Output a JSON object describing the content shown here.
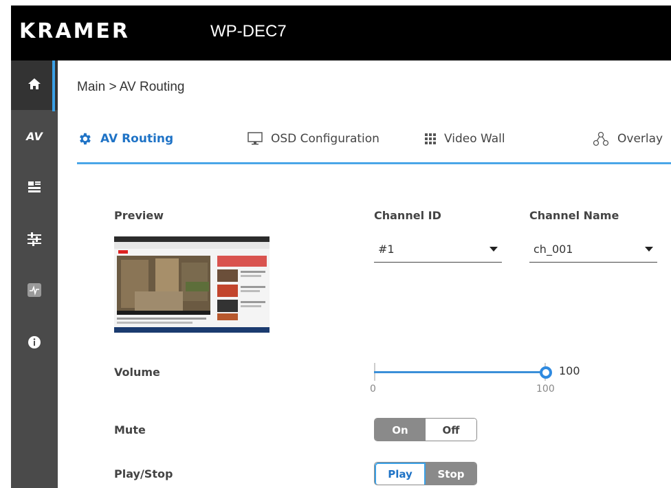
{
  "header": {
    "logo": "KRAMER",
    "product": "WP-DEC7"
  },
  "sidebar": {
    "items": [
      {
        "name": "home-icon"
      },
      {
        "name": "av-icon",
        "label": "AV"
      },
      {
        "name": "settings-panel-icon"
      },
      {
        "name": "sliders-icon"
      },
      {
        "name": "diagnostics-icon"
      },
      {
        "name": "info-icon"
      }
    ]
  },
  "breadcrumb": "Main > AV Routing",
  "tabs": [
    {
      "label": "AV Routing",
      "icon": "gear-icon",
      "active": true
    },
    {
      "label": "OSD Configuration",
      "icon": "monitor-icon"
    },
    {
      "label": "Video Wall",
      "icon": "grid-icon"
    },
    {
      "label": "Overlay",
      "icon": "overlay-icon"
    }
  ],
  "labels": {
    "preview": "Preview",
    "channel_id": "Channel ID",
    "channel_name": "Channel Name",
    "volume": "Volume",
    "mute": "Mute",
    "play_stop": "Play/Stop"
  },
  "channel_id": {
    "value": "#1"
  },
  "channel_name": {
    "value": "ch_001"
  },
  "volume": {
    "value": "100",
    "min_label": "0",
    "max_label": "100",
    "level": 1.0
  },
  "mute": {
    "on_label": "On",
    "off_label": "Off",
    "selected": "Off"
  },
  "play_stop": {
    "play_label": "Play",
    "stop_label": "Stop",
    "selected": "Play"
  },
  "colors": {
    "accent": "#3aa0e6",
    "active_text": "#1f73c6",
    "sidebar": "#4a4a4a",
    "header": "#000000"
  }
}
